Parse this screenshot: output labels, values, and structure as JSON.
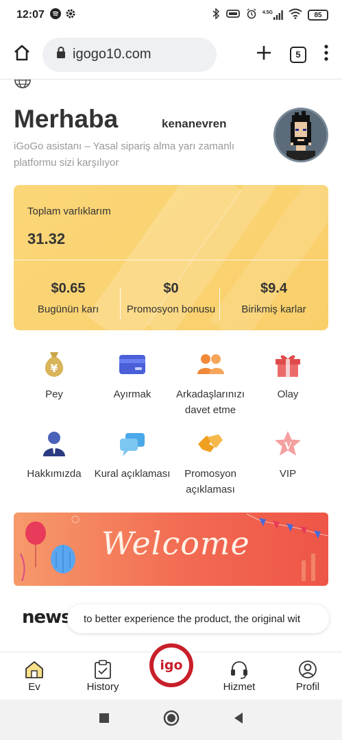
{
  "status_bar": {
    "time": "12:07",
    "network_label": "4.5G",
    "battery": "85"
  },
  "browser": {
    "url": "igogo10.com",
    "tab_count": "5"
  },
  "header": {
    "greeting": "Merhaba",
    "username": "kenanevren",
    "subtitle": "iGoGo asistanı – Yasal sipariş alma yarı zamanlı platformu sizi karşılıyor"
  },
  "assets": {
    "label": "Toplam varlıklarım",
    "total": "31.32",
    "stats": [
      {
        "value": "$0.65",
        "label": "Bugünün karı"
      },
      {
        "value": "$0",
        "label": "Promosyon bonusu"
      },
      {
        "value": "$9.4",
        "label": "Birikmiş karlar"
      }
    ]
  },
  "menu": [
    {
      "label": "Pey",
      "icon": "money-bag-icon"
    },
    {
      "label": "Ayırmak",
      "icon": "card-icon"
    },
    {
      "label": "Arkadaşlarınızı davet etme",
      "icon": "people-icon"
    },
    {
      "label": "Olay",
      "icon": "gift-icon"
    },
    {
      "label": "Hakkımızda",
      "icon": "person-icon"
    },
    {
      "label": "Kural açıklaması",
      "icon": "chat-icon"
    },
    {
      "label": "Promosyon açıklaması",
      "icon": "handshake-icon"
    },
    {
      "label": "VIP",
      "icon": "vip-star-icon"
    }
  ],
  "banner": {
    "text": "Welcome"
  },
  "news": {
    "logo": "news",
    "ticker": "to better experience the product, the original wit"
  },
  "tabbar": {
    "items": [
      {
        "label": "Ev",
        "icon": "home-icon"
      },
      {
        "label": "History",
        "icon": "history-icon"
      },
      {
        "label": "Hizmet",
        "icon": "headset-icon"
      },
      {
        "label": "Profil",
        "icon": "profile-icon"
      }
    ],
    "center_logo": "igo"
  },
  "colors": {
    "card_gold": "#f9cf6a",
    "brand_red": "#c81f2a",
    "banner_orange": "#f26a52"
  }
}
